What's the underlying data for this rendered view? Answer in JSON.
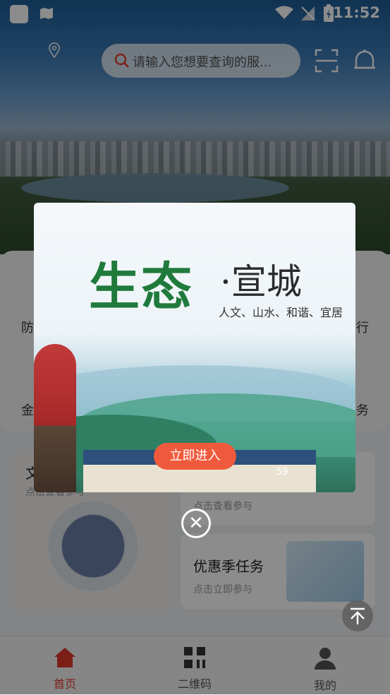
{
  "status_bar": {
    "time": "11:52"
  },
  "search": {
    "placeholder": "请输入您想要查询的服..."
  },
  "side_labels": {
    "left1": "防",
    "left2": "金",
    "right1": "行",
    "right2": "务"
  },
  "tiles": {
    "left_title": "文",
    "left_sub": "点击查看参与",
    "top_right_sub": "点击查看参与",
    "promo_title": "优惠季任务",
    "promo_sub": "点击立即参与"
  },
  "nav": {
    "items": [
      {
        "label": "首页",
        "active": true
      },
      {
        "label": "二维码",
        "active": false
      },
      {
        "label": "我的",
        "active": false
      }
    ]
  },
  "popup": {
    "title_main": "生态",
    "title_city": "·宣城",
    "subtitle": "人文、山水、和谐、宜居",
    "enter_button": "立即进入",
    "count": "59"
  },
  "colors": {
    "accent": "#e23b2a",
    "enter_button": "#f05a3c"
  },
  "icons": [
    "location-icon",
    "search-icon",
    "scan-icon",
    "bell-icon",
    "close-icon",
    "back-to-top-icon",
    "home-icon",
    "qrcode-icon",
    "user-icon"
  ]
}
